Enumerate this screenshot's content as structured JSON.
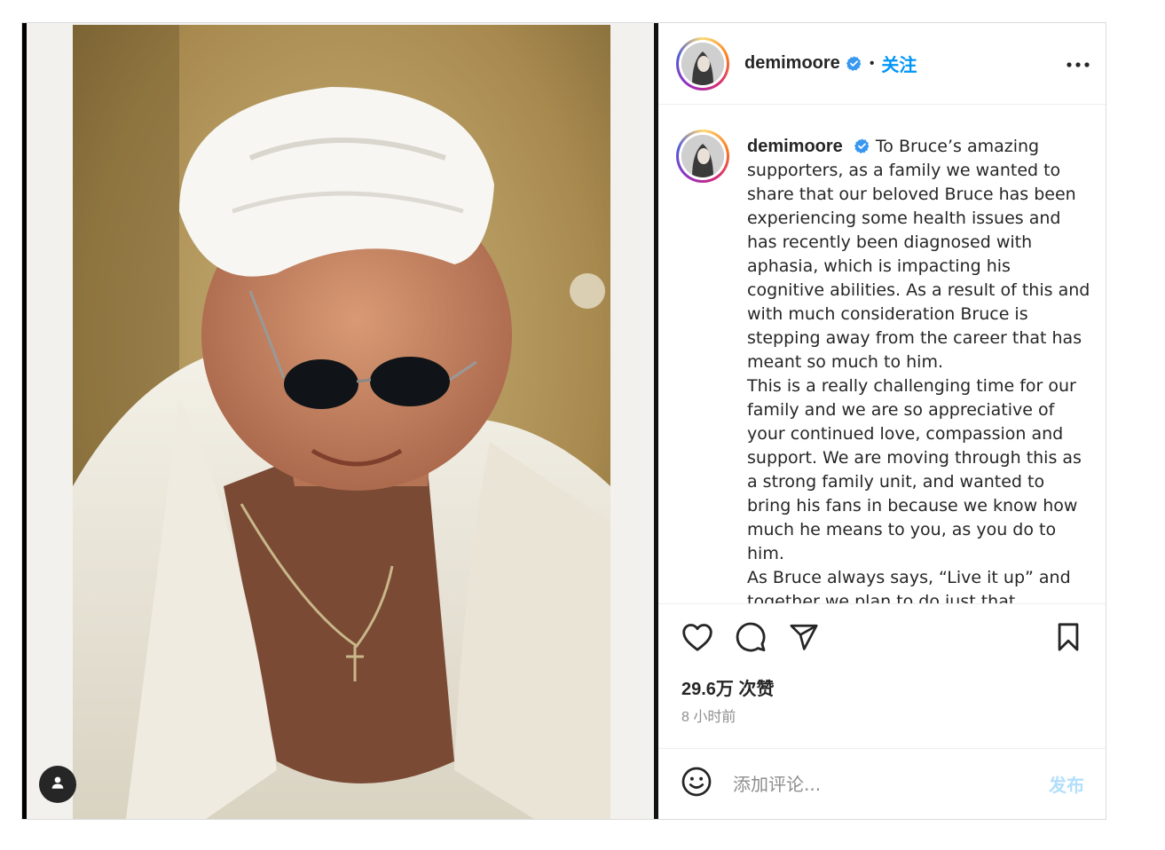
{
  "post": {
    "author": {
      "username": "demimoore",
      "verified": true,
      "follow_label": "关注"
    },
    "caption": {
      "username": "demimoore",
      "paragraphs": [
        "To Bruce’s amazing supporters, as a family we wanted to share that our beloved Bruce has been experiencing some health issues and has recently been diagnosed with aphasia, which is impacting his cognitive abilities. As a result of this and with much consideration Bruce is stepping away from the career that has meant so much to him.",
        "This is a really challenging time for our family and we are so appreciative of your continued love, compassion and support. We are moving through this as a strong family unit, and wanted to bring his fans in because we know how much he means to you, as you do to him.",
        "As Bruce always says, “Live it up” and together we plan to do just that."
      ]
    },
    "likes_label": "29.6万 次赞",
    "time_label": "8 小时前",
    "comment": {
      "placeholder": "添加评论...",
      "publish_label": "发布"
    },
    "colors": {
      "accent": "#0095f6",
      "publish_disabled": "#b2dffc",
      "verified": "#3897f0"
    },
    "icons": {
      "tag": "user-tag-icon",
      "more": "more-options-icon",
      "like": "heart-icon",
      "comment": "comment-icon",
      "share": "share-icon",
      "save": "bookmark-icon",
      "emoji": "emoji-icon",
      "verified": "verified-badge-icon"
    }
  }
}
